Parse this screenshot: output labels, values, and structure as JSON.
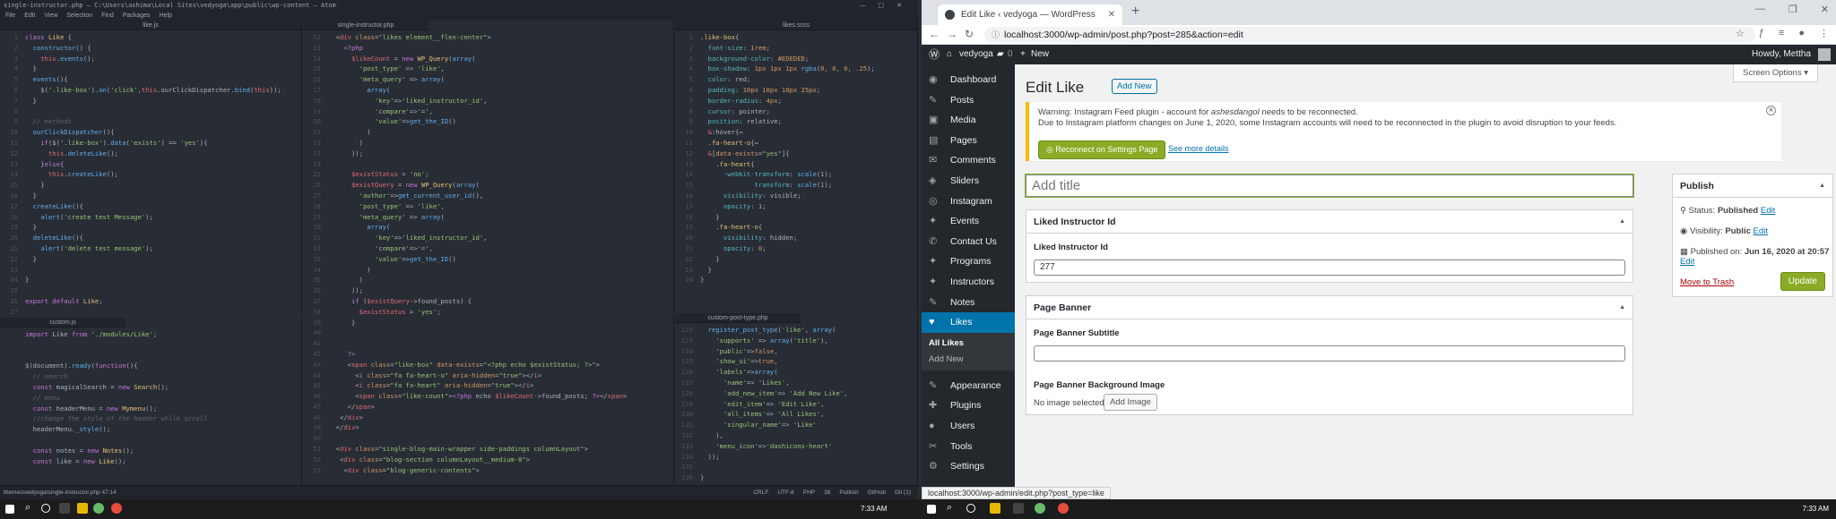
{
  "atom": {
    "title": "single-instructor.php — C:\\Users\\ashima\\Local Sites\\vedyoga\\app\\public\\wp-content — Atom",
    "menu": [
      "File",
      "Edit",
      "View",
      "Selection",
      "Find",
      "Packages",
      "Help"
    ],
    "tabs": {
      "like": "like.js",
      "single": "single-instructor.php",
      "likes_scss": "likes.scss",
      "custom": "custom.js",
      "cpt": "custom-post-type.php"
    },
    "status_left": "themes\\vedyoga\\single-instructor.php  47:14",
    "status_right": [
      "CRLF",
      "UTF-8",
      "PHP",
      "38",
      "Publish",
      "GitHub",
      "Git (1)"
    ]
  },
  "browser": {
    "tab_title": "Edit Like ‹ vedyoga — WordPress",
    "url": "localhost:3000/wp-admin/post.php?post=285&action=edit",
    "status_url": "localhost:3000/wp-admin/edit.php?post_type=like"
  },
  "adminbar": {
    "site": "vedyoga",
    "comments": "0",
    "new": "New",
    "howdy": "Howdy, Mettha"
  },
  "menu": [
    {
      "label": "Dashboard",
      "icon": "dashboard-icon",
      "g": "◉"
    },
    {
      "label": "Posts",
      "icon": "pin-icon",
      "g": "✎"
    },
    {
      "label": "Media",
      "icon": "media-icon",
      "g": "▣"
    },
    {
      "label": "Pages",
      "icon": "pages-icon",
      "g": "▤"
    },
    {
      "label": "Comments",
      "icon": "comments-icon",
      "g": "✉"
    },
    {
      "label": "Sliders",
      "icon": "sliders-icon",
      "g": "◈"
    },
    {
      "label": "Instagram",
      "icon": "instagram-icon",
      "g": "◎"
    },
    {
      "label": "Events",
      "icon": "events-icon",
      "g": "✦"
    },
    {
      "label": "Contact Us",
      "icon": "contact-icon",
      "g": "✆"
    },
    {
      "label": "Programs",
      "icon": "programs-icon",
      "g": "✦"
    },
    {
      "label": "Instructors",
      "icon": "instructors-icon",
      "g": "✦"
    },
    {
      "label": "Notes",
      "icon": "notes-icon",
      "g": "✎"
    }
  ],
  "menu_active": {
    "label": "Likes",
    "g": "♥"
  },
  "submenu": [
    "All Likes",
    "Add New"
  ],
  "menu2": [
    {
      "label": "Appearance",
      "icon": "appearance-icon",
      "g": "✎"
    },
    {
      "label": "Plugins",
      "icon": "plugins-icon",
      "g": "✚"
    },
    {
      "label": "Users",
      "icon": "users-icon",
      "g": "●"
    },
    {
      "label": "Tools",
      "icon": "tools-icon",
      "g": "✂"
    },
    {
      "label": "Settings",
      "icon": "settings-icon",
      "g": "⚙"
    }
  ],
  "page": {
    "heading": "Edit Like",
    "add_new": "Add New",
    "screen_options": "Screen Options ▾",
    "notice_title": "Warning: Instagram Feed plugin - account for ",
    "notice_account": "ashesdangol",
    "notice_tail": " needs to be reconnected.",
    "notice_body": "Due to Instagram platform changes on June 1, 2020, some Instagram accounts will need to be reconnected in the plugin to avoid disruption to your feeds.",
    "reconnect": "Reconnect on Settings Page",
    "see_more": "See more details",
    "title_placeholder": "Add title",
    "box1_title": "Liked Instructor Id",
    "box1_label": "Liked Instructor Id",
    "box1_value": "277",
    "box2_title": "Page Banner",
    "box2_label1": "Page Banner Subtitle",
    "box2_label2": "Page Banner Background Image",
    "no_image": "No image selected",
    "add_image": "Add Image",
    "publish": "Publish",
    "status_lbl": "Status: ",
    "status_val": "Published",
    "visibility_lbl": "Visibility: ",
    "visibility_val": "Public",
    "published_lbl": "Published on: ",
    "published_val": "Jun 16, 2020 at 20:57",
    "edit": "Edit",
    "trash": "Move to Trash",
    "update": "Update"
  },
  "taskbar": {
    "time_left": "7:33 AM",
    "time_right": "7:33 AM"
  }
}
